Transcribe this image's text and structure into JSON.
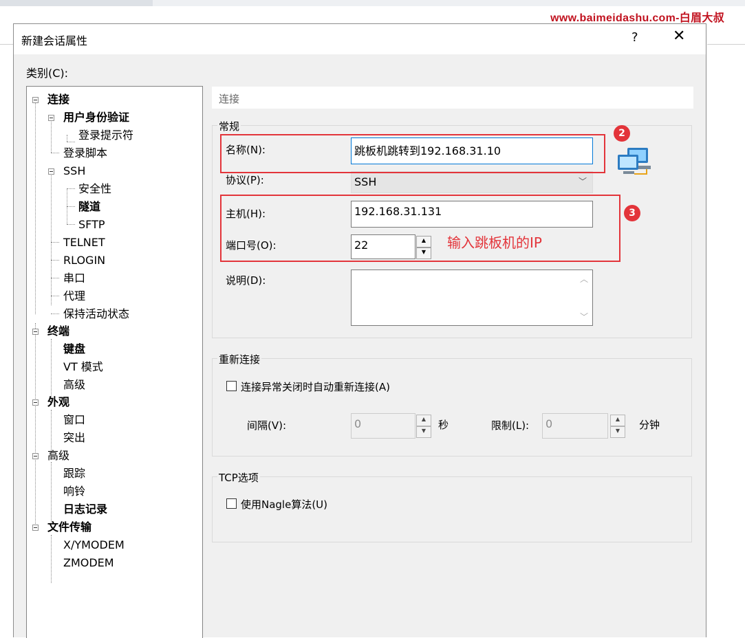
{
  "watermark": "www.baimeidashu.com-白眉大叔",
  "dialog": {
    "title": "新建会话属性",
    "help": "?",
    "close": "✕",
    "category_label": "类别(C):"
  },
  "tree": [
    {
      "label": "连接",
      "bold": true
    },
    {
      "label": "用户身份验证",
      "bold": true
    },
    {
      "label": "登录提示符",
      "bold": false
    },
    {
      "label": "登录脚本",
      "bold": false
    },
    {
      "label": "SSH",
      "bold": false
    },
    {
      "label": "安全性",
      "bold": false
    },
    {
      "label": "隧道",
      "bold": true
    },
    {
      "label": "SFTP",
      "bold": false
    },
    {
      "label": "TELNET",
      "bold": false
    },
    {
      "label": "RLOGIN",
      "bold": false
    },
    {
      "label": "串口",
      "bold": false
    },
    {
      "label": "代理",
      "bold": false
    },
    {
      "label": "保持活动状态",
      "bold": false
    },
    {
      "label": "终端",
      "bold": true
    },
    {
      "label": "键盘",
      "bold": true
    },
    {
      "label": "VT 模式",
      "bold": false
    },
    {
      "label": "高级",
      "bold": false
    },
    {
      "label": "外观",
      "bold": true
    },
    {
      "label": "窗口",
      "bold": false
    },
    {
      "label": "突出",
      "bold": false
    },
    {
      "label": "高级",
      "bold": false
    },
    {
      "label": "跟踪",
      "bold": false
    },
    {
      "label": "响铃",
      "bold": false
    },
    {
      "label": "日志记录",
      "bold": true
    },
    {
      "label": "文件传输",
      "bold": true
    },
    {
      "label": "X/YMODEM",
      "bold": false
    },
    {
      "label": "ZMODEM",
      "bold": false
    }
  ],
  "panel": {
    "header": "连接",
    "general": {
      "group_label": "常规",
      "name_label": "名称(N):",
      "name_value": "跳板机跳转到192.168.31.10",
      "protocol_label": "协议(P):",
      "protocol_value": "SSH",
      "host_label": "主机(H):",
      "host_value": "192.168.31.131",
      "port_label": "端口号(O):",
      "port_value": "22",
      "desc_label": "说明(D):",
      "desc_value": ""
    },
    "reconnect": {
      "group_label": "重新连接",
      "checkbox_label": "连接异常关闭时自动重新连接(A)",
      "checked": false,
      "interval_label": "间隔(V):",
      "interval_value": "0",
      "interval_unit": "秒",
      "limit_label": "限制(L):",
      "limit_value": "0",
      "limit_unit": "分钟"
    },
    "tcp": {
      "group_label": "TCP选项",
      "nagle_label": "使用Nagle算法(U)",
      "checked": false
    }
  },
  "annotations": {
    "badge_2": "2",
    "badge_3": "3",
    "note": "输入跳板机的IP",
    "color": "#e3343a"
  }
}
